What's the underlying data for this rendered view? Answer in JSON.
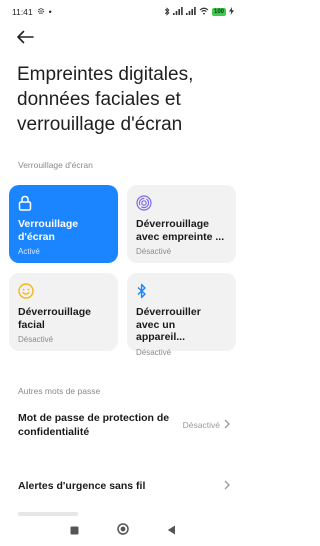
{
  "status_bar": {
    "time": "11:41",
    "battery": "100"
  },
  "header": {
    "title": "Empreintes digitales, données faciales et verrouillage d'écran"
  },
  "sections": {
    "lock_label": "Verrouillage d'écran",
    "other_label": "Autres mots de passe"
  },
  "cards": [
    {
      "title": "Verrouillage d'écran",
      "status": "Activé"
    },
    {
      "title": "Déverrouillage avec empreinte ...",
      "status": "Désactivé"
    },
    {
      "title": "Déverrouillage facial",
      "status": "Désactivé"
    },
    {
      "title": "Déverrouiller avec un appareil...",
      "status": "Désactivé"
    }
  ],
  "list": [
    {
      "title": "Mot de passe de protection de confidentialité",
      "value": "Désactivé"
    },
    {
      "title": "Alertes d'urgence sans fil"
    }
  ],
  "colors": {
    "accent": "#1a85ff",
    "card_bg": "#f2f2f2",
    "face_icon": "#f2b619",
    "fingerprint_icon": "#7b6ce8"
  }
}
